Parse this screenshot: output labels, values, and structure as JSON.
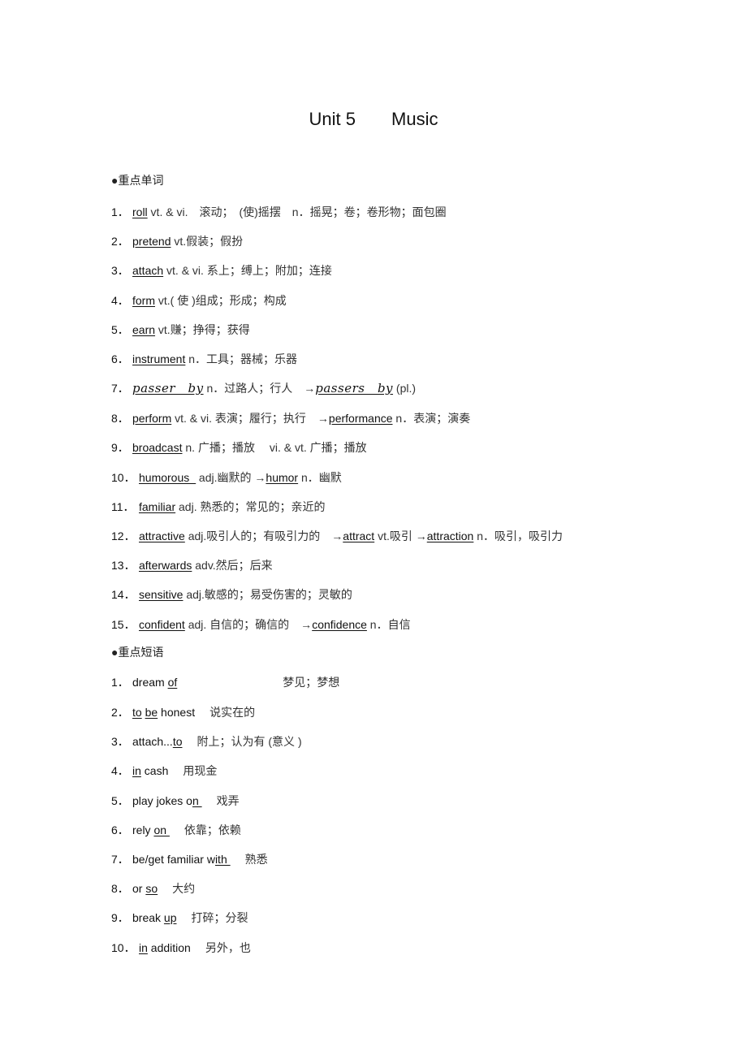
{
  "title": {
    "unit": "Unit 5",
    "topic": "Music"
  },
  "sections": {
    "words_heading": "●重点单词",
    "phrases_heading": "●重点短语"
  },
  "words": [
    {
      "n": "1．",
      "w": "roll",
      "rest": " vt. & vi.　滚动；　(使)摇摆　n．摇晃；卷；卷形物；面包圈"
    },
    {
      "n": "2．",
      "w": "pretend",
      "rest": " vt.假装；假扮"
    },
    {
      "n": "3．",
      "w": "attach",
      "rest": " vt. & vi. 系上；缚上；附加；连接"
    },
    {
      "n": "4．",
      "w": "form",
      "rest": " vt.( 使 )组成；形成；构成"
    },
    {
      "n": "5．",
      "w": "earn",
      "rest": " vt.赚；挣得；获得"
    },
    {
      "n": "6．",
      "w": "instrument",
      "rest": " n．工具；器械；乐器"
    },
    {
      "n": "7．",
      "w": "passer　by",
      "rest": " n．过路人；行人　→",
      "w2": "passers　by",
      "rest2": " (pl.)"
    },
    {
      "n": "8．",
      "w": "perform",
      "rest": " vt. & vi. 表演；履行；执行　→",
      "w2": "performance",
      "rest2": " n．表演；演奏"
    },
    {
      "n": "9．",
      "w": "broadcast",
      "rest": " n. 广播；播放　 vi. & vt. 广播；播放"
    },
    {
      "n": "10．",
      "w": "humorous_",
      "rest": " adj.幽默的 →",
      "w2": "humor",
      "rest2": " n．幽默"
    },
    {
      "n": "11．",
      "w": "familiar",
      "rest": " adj. 熟悉的；常见的；亲近的"
    },
    {
      "n": "12．",
      "w": "attractive",
      "rest": " adj.吸引人的；有吸引力的　→",
      "w2": "attract",
      "rest2": " vt.吸引 →",
      "w3": "attraction",
      "rest3": " n．吸引，吸引力"
    },
    {
      "n": "13．",
      "w": "afterwards",
      "rest": " adv.然后；后来"
    },
    {
      "n": "14．",
      "w": "sensitive",
      "rest": " adj.敏感的；易受伤害的；灵敏的"
    },
    {
      "n": "15．",
      "w": "confident",
      "rest": " adj. 自信的；确信的　→",
      "w2": "confidence",
      "rest2": " n．自信"
    }
  ],
  "phrases": [
    {
      "n": "1．",
      "pre": "dream ",
      "u": "of",
      "post": "",
      "cn": "梦见；梦想"
    },
    {
      "n": "2．",
      "pre": "",
      "u": "to",
      "mid": " ",
      "u2": "be",
      "post": " honest",
      "cn": "说实在的"
    },
    {
      "n": "3．",
      "pre": "attach...",
      "u": "to",
      "post": "",
      "cn": "附上；认为有 (意义 )"
    },
    {
      "n": "4．",
      "pre": "",
      "u": "in",
      "post": " cash",
      "cn": "用现金"
    },
    {
      "n": "5．",
      "pre": "play jokes o",
      "u": "n ",
      "post": "",
      "cn": "戏弄"
    },
    {
      "n": "6．",
      "pre": "rely ",
      "u": "on ",
      "post": "",
      "cn": "依靠；依赖"
    },
    {
      "n": "7．",
      "pre": "be/get familiar w",
      "u": "ith  ",
      "post": "",
      "cn": "熟悉"
    },
    {
      "n": "8．",
      "pre": "or ",
      "u": "so",
      "post": "",
      "cn": "大约"
    },
    {
      "n": "9．",
      "pre": "break ",
      "u": "up",
      "post": "",
      "cn": "打碎；分裂"
    },
    {
      "n": "10．",
      "pre": "",
      "u": "in",
      "post": " addition",
      "cn": "另外，也"
    }
  ]
}
